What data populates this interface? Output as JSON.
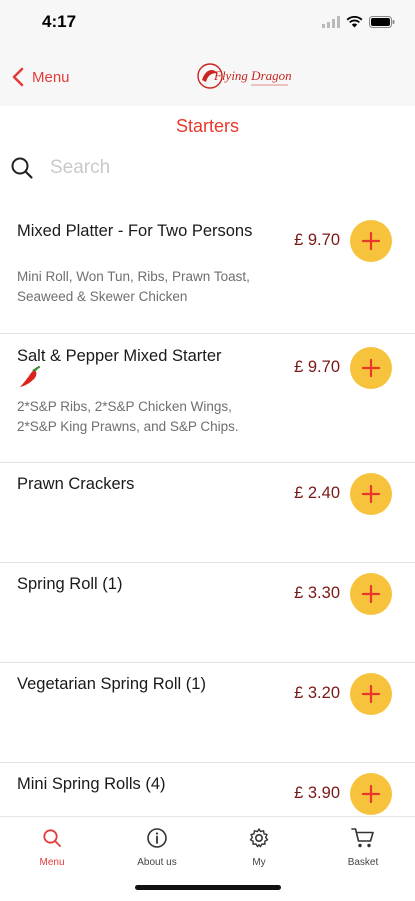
{
  "status": {
    "time": "4:17"
  },
  "nav": {
    "back_label": "Menu",
    "logo_text": "Flying Dragon"
  },
  "page": {
    "title": "Starters"
  },
  "search": {
    "placeholder": "Search"
  },
  "items": [
    {
      "name": "Mixed Platter - For Two Persons",
      "desc": "Mini Roll, Won Tun, Ribs, Prawn Toast, Seaweed & Skewer Chicken",
      "price": "£ 9.70"
    },
    {
      "name": "Salt & Pepper Mixed Starter",
      "desc": "2*S&P Ribs, 2*S&P Chicken Wings, 2*S&P King Prawns, and S&P Chips.",
      "price": "£ 9.70",
      "icon": "chili-pepper-icon"
    },
    {
      "name": "Prawn Crackers",
      "desc": "",
      "price": "£ 2.40"
    },
    {
      "name": "Spring Roll (1)",
      "desc": "",
      "price": "£ 3.30"
    },
    {
      "name": "Vegetarian Spring Roll (1)",
      "desc": "",
      "price": "£ 3.20"
    },
    {
      "name": "Mini Spring Rolls (4)",
      "desc": "",
      "price": "£ 3.90"
    }
  ],
  "tabs": [
    {
      "label": "Menu",
      "icon": "search-icon",
      "active": true
    },
    {
      "label": "About us",
      "icon": "info-icon",
      "active": false
    },
    {
      "label": "My",
      "icon": "gear-icon",
      "active": false
    },
    {
      "label": "Basket",
      "icon": "cart-icon",
      "active": false
    }
  ],
  "colors": {
    "accent": "#e33b3b",
    "price": "#7a1818",
    "add_button": "#f8c33c"
  }
}
